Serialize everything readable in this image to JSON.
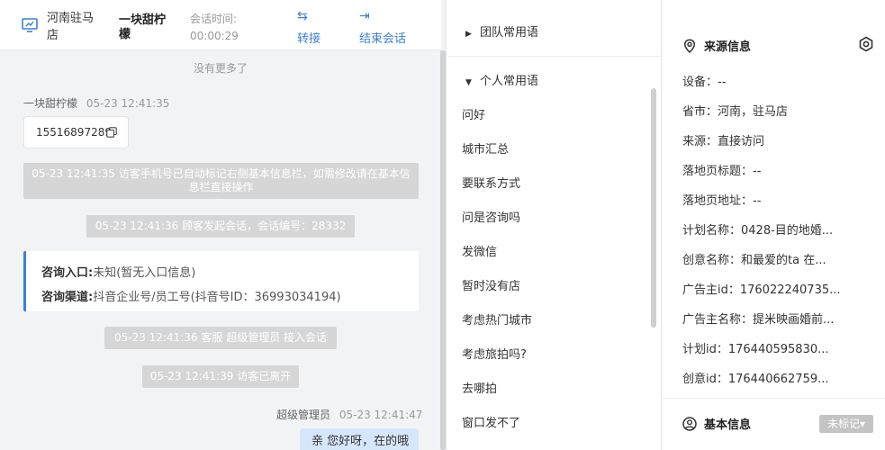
{
  "header": {
    "shop": "河南驻马店",
    "visitor": "一块甜柠檬",
    "session_time_label": "会话时间:",
    "session_time_value": "00:00:29",
    "transfer_label": "转接",
    "end_label": "结束会话",
    "accent": "#3a7fd5"
  },
  "chat": {
    "no_more": "没有更多了",
    "visitor_name": "一块甜柠檬",
    "visitor_time": "05-23 12:41:35",
    "phone": "15516897289",
    "system_messages": [
      "05-23 12:41:35 访客手机号已自动标记右侧基本信息栏，如需修改请在基本信息栏直接操作",
      "05-23 12:41:36 顾客发起会话，会话编号：28332",
      "05-23 12:41:36 客服 超级管理员 接入会话",
      "05-23 12:41:39 访客已离开"
    ],
    "entry": {
      "entry_key": "咨询入口:",
      "entry_value": "未知(暂无入口信息)",
      "channel_key": "咨询渠道:",
      "channel_value": "抖音企业号/员工号(抖音号ID：36993034194)"
    },
    "agent_name": "超级管理员",
    "agent_time": "05-23 12:41:47",
    "agent_message": "亲 您好呀，在的哦"
  },
  "phrases": {
    "team_group": "团队常用语",
    "personal_group": "个人常用语",
    "items": [
      "问好",
      "城市汇总",
      "要联系方式",
      "问是咨询吗",
      "发微信",
      "暂时没有店",
      "考虑热门城市",
      "考虑旅拍吗?",
      "去哪拍",
      "窗口发不了"
    ]
  },
  "source_info": {
    "title": "来源信息",
    "rows": [
      "设备：--",
      "省市：河南，驻马店",
      "来源：直接访问",
      "落地页标题：--",
      "落地页地址：--",
      "计划名称：0428-目的地婚...",
      "创意名称：和最爱的ta 在...",
      "广告主id：176022240735...",
      "广告主名称：提米映画婚前...",
      "计划id：176440595830...",
      "创意id：176440662759..."
    ]
  },
  "basic_info": {
    "title": "基本信息",
    "tag": "未标记▾"
  }
}
